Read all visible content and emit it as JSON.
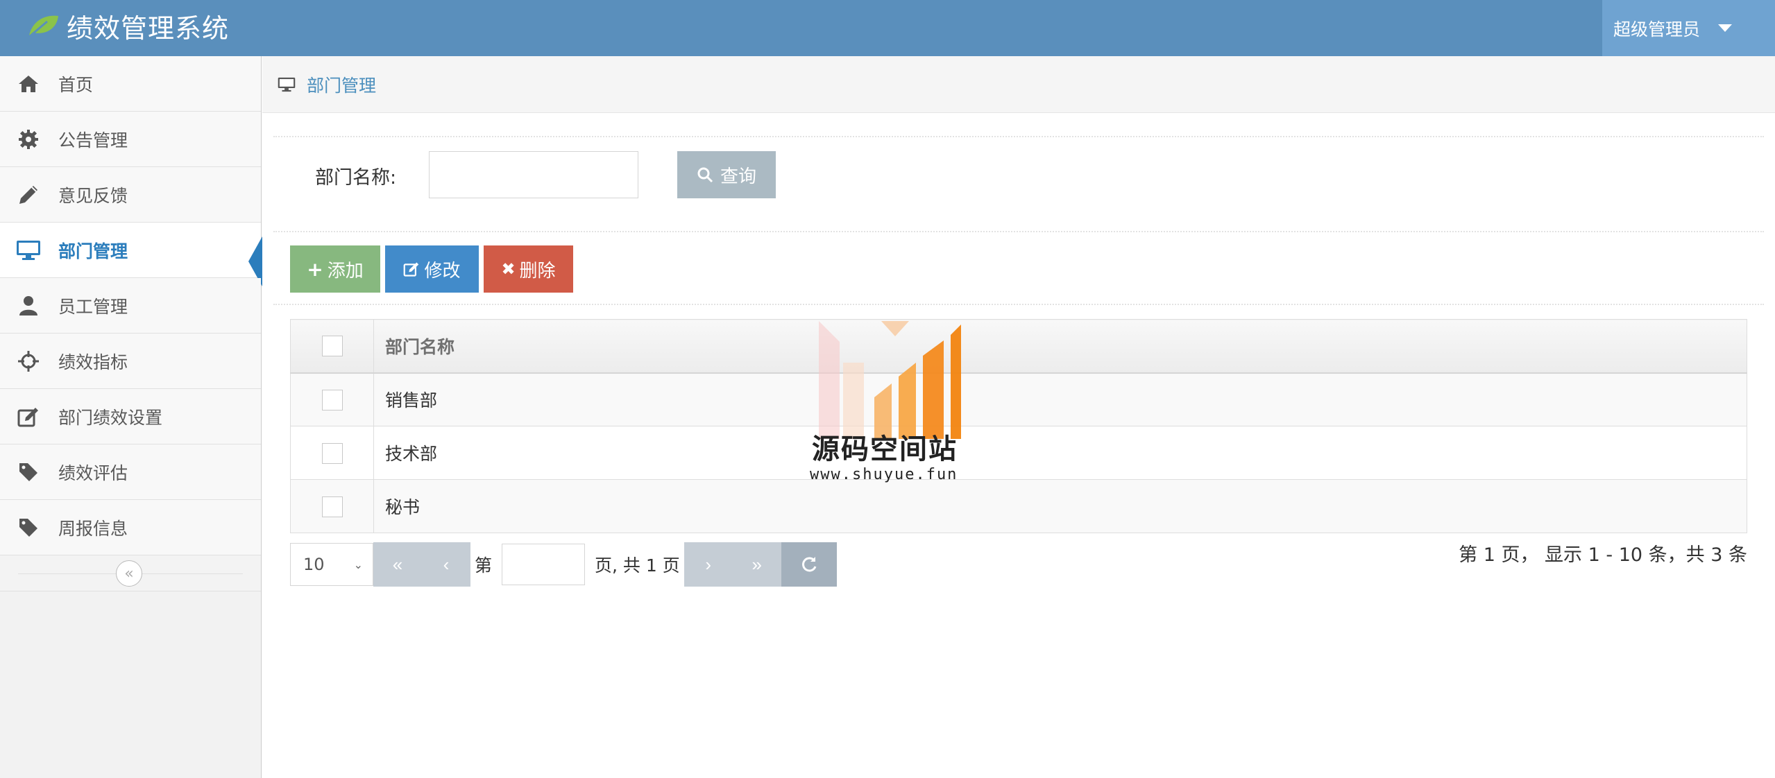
{
  "app": {
    "title": "绩效管理系统"
  },
  "user": {
    "name": "超级管理员"
  },
  "sidebar": {
    "items": [
      {
        "label": "首页",
        "icon": "home-icon"
      },
      {
        "label": "公告管理",
        "icon": "gear-icon"
      },
      {
        "label": "意见反馈",
        "icon": "pencil-icon"
      },
      {
        "label": "部门管理",
        "icon": "desktop-icon",
        "active": true
      },
      {
        "label": "员工管理",
        "icon": "user-icon"
      },
      {
        "label": "绩效指标",
        "icon": "crosshairs-icon"
      },
      {
        "label": "部门绩效设置",
        "icon": "edit-icon"
      },
      {
        "label": "绩效评估",
        "icon": "tag-icon"
      },
      {
        "label": "周报信息",
        "icon": "tag-icon"
      }
    ]
  },
  "breadcrumb": {
    "label": "部门管理"
  },
  "search": {
    "label": "部门名称:",
    "value": "",
    "button": "查询"
  },
  "toolbar": {
    "add": "添加",
    "edit": "修改",
    "delete": "删除"
  },
  "table": {
    "header": "部门名称",
    "rows": [
      "销售部",
      "技术部",
      "秘书"
    ]
  },
  "pager": {
    "page_size": "10",
    "first": "«",
    "prev": "‹",
    "next": "›",
    "last": "»",
    "page_prefix": "第",
    "page_value": "",
    "page_suffix": "页, 共 1 页",
    "info": "第 1 页， 显示 1 - 10 条，共 3 条"
  },
  "watermark": {
    "title": "源码空间站",
    "url": "www.shuyue.fun"
  },
  "colors": {
    "navbar": "#5a8fbc",
    "active": "#2b7dbc",
    "add": "#87b87f",
    "edit": "#428bca",
    "delete": "#d15b47"
  }
}
